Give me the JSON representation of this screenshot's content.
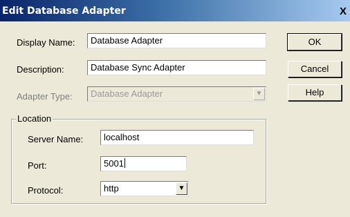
{
  "window": {
    "title": "Edit Database Adapter",
    "close_glyph": "X"
  },
  "form": {
    "display_name_label": "Display Name:",
    "display_name_value": "Database Adapter",
    "description_label": "Description:",
    "description_value": "Database Sync Adapter",
    "adapter_type_label": "Adapter Type:",
    "adapter_type_value": "Database Adapter",
    "adapter_type_disabled": true
  },
  "location": {
    "legend": "Location",
    "server_name_label": "Server Name:",
    "server_name_value": "localhost",
    "port_label": "Port:",
    "port_value": "5001",
    "protocol_label": "Protocol:",
    "protocol_value": "http"
  },
  "buttons": {
    "ok": "OK",
    "cancel": "Cancel",
    "help": "Help"
  },
  "icons": {
    "dropdown_arrow": "▼"
  },
  "colors": {
    "dialog_bg": "#ece9d8",
    "titlebar_start": "#0a246a",
    "titlebar_end": "#a6caf0",
    "disabled_text": "#9a9a9a"
  }
}
